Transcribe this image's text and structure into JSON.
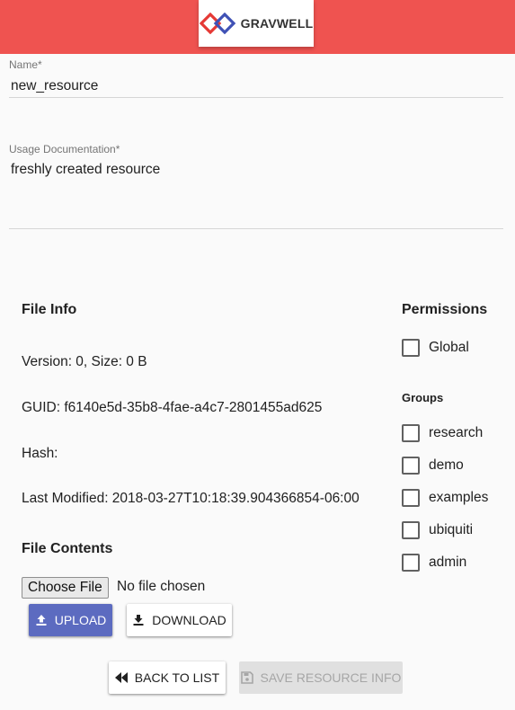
{
  "header": {
    "logo_text": "GRAVWELL"
  },
  "form": {
    "name_label": "Name",
    "name_value": "new_resource",
    "doc_label": "Usage Documentation",
    "doc_value": "freshly created resource",
    "required_marker": "*"
  },
  "file_info": {
    "title": "File Info",
    "version_size": "Version: 0, Size: 0 B",
    "guid": "GUID: f6140e5d-35b8-4fae-a4c7-2801455ad625",
    "hash": "Hash:",
    "last_modified": "Last Modified: 2018-03-27T10:18:39.904366854-06:00"
  },
  "file_contents": {
    "title": "File Contents",
    "choose_file_label": "Choose File",
    "no_file_text": "No file chosen",
    "upload_label": "UPLOAD",
    "download_label": "DOWNLOAD"
  },
  "permissions": {
    "title": "Permissions",
    "global_label": "Global",
    "groups_title": "Groups",
    "groups": [
      "research",
      "demo",
      "examples",
      "ubiquiti",
      "admin"
    ]
  },
  "actions": {
    "back_label": "BACK TO LIST",
    "save_label": "SAVE RESOURCE INFO"
  },
  "colors": {
    "header_bg": "#ef5350",
    "primary": "#5c6bc0",
    "disabled_bg": "#e0e0e0"
  },
  "icons": {
    "logo": "gravwell-logo-icon",
    "upload": "upload-icon",
    "download": "download-icon",
    "back": "rewind-icon",
    "save": "floppy-disk-icon"
  }
}
